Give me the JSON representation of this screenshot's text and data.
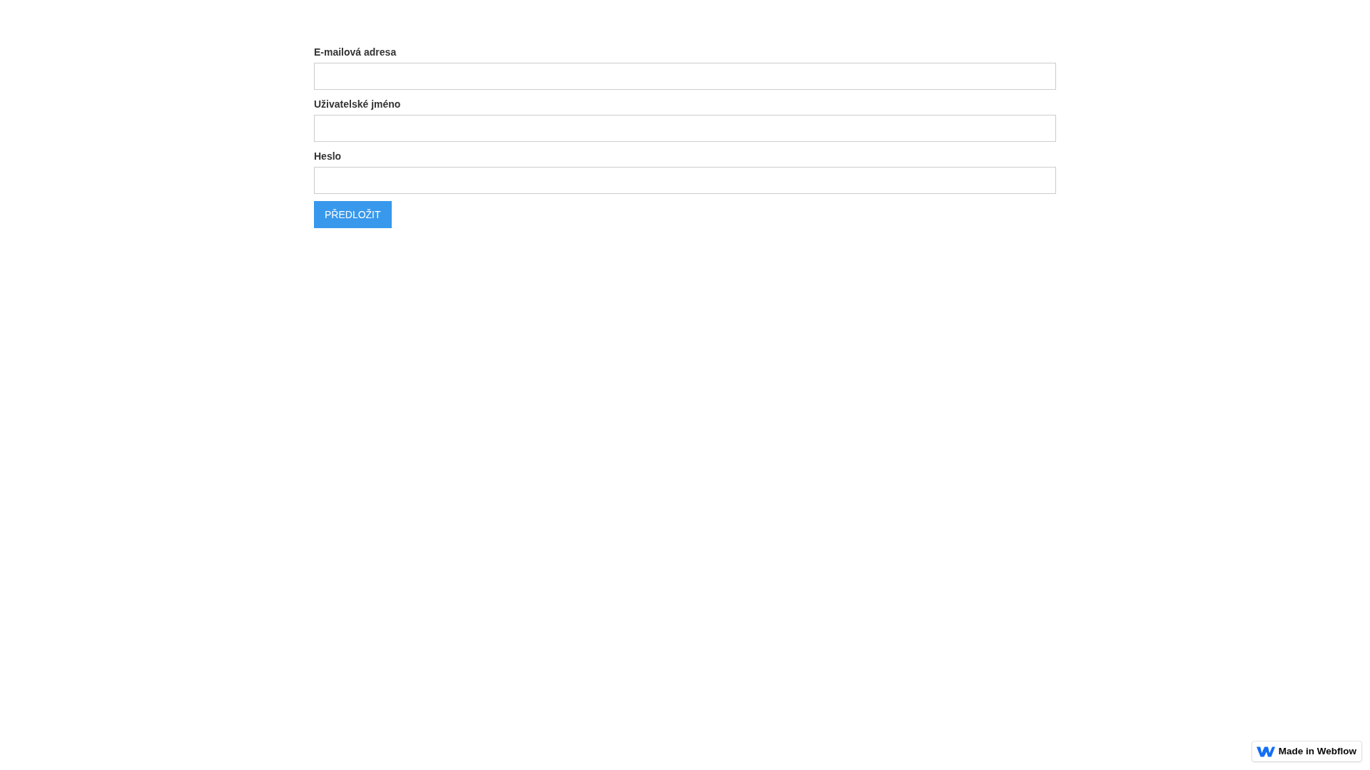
{
  "form": {
    "fields": [
      {
        "label": "E-mailová adresa"
      },
      {
        "label": "Uživatelské jméno"
      },
      {
        "label": "Heslo"
      }
    ],
    "submit": "PŘEDLOŽIT"
  },
  "badge": {
    "text": "Made in Webflow"
  }
}
